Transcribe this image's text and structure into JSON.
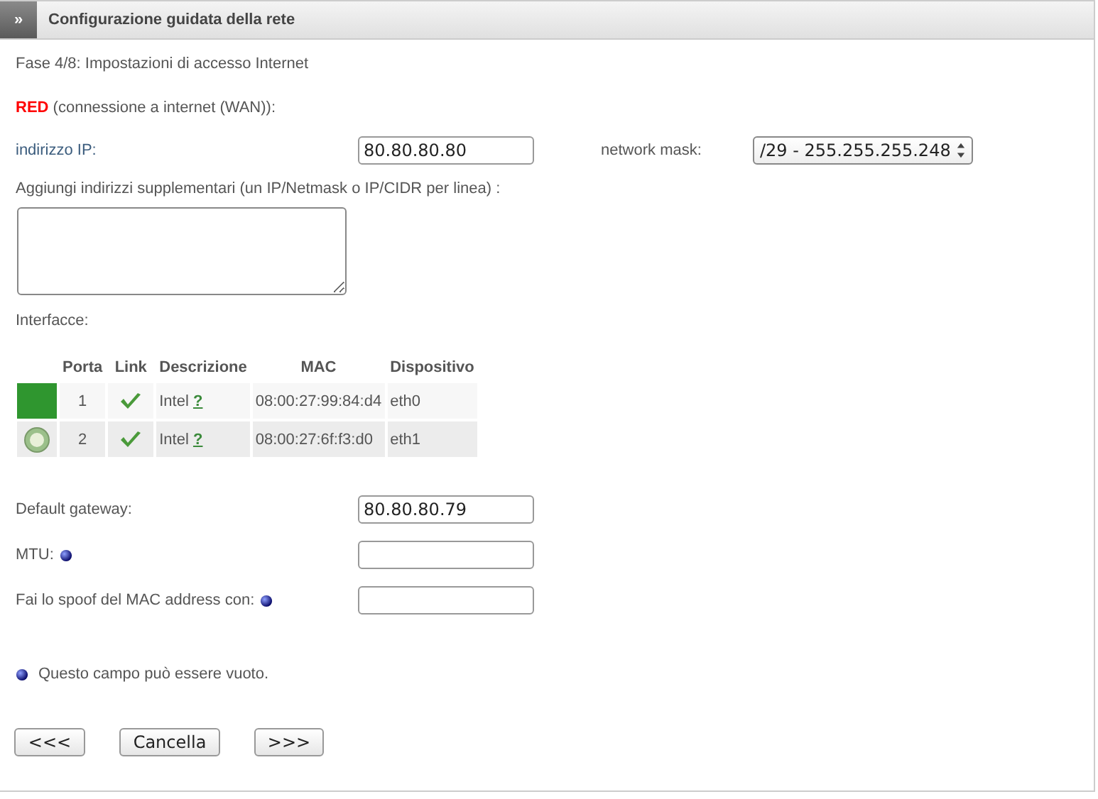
{
  "header": {
    "toggle": "»",
    "title": "Configurazione guidata della rete"
  },
  "step": "Fase 4/8: Impostazioni di accesso Internet",
  "zone": {
    "name": "RED",
    "description": "(connessione a internet (WAN)):"
  },
  "ip": {
    "label": "indirizzo IP:",
    "value": "80.80.80.80"
  },
  "netmask": {
    "label": "network mask:",
    "value": "/29 - 255.255.255.248"
  },
  "extra": {
    "label": "Aggiungi indirizzi supplementari (un IP/Netmask o IP/CIDR per linea) :"
  },
  "interfaces": {
    "label": "Interfacce:",
    "columns": [
      "Porta",
      "Link",
      "Descrizione",
      "MAC",
      "Dispositivo"
    ],
    "rows": [
      {
        "selected": true,
        "port": "1",
        "link": true,
        "description": "Intel",
        "help": "?",
        "mac": "08:00:27:99:84:d4",
        "device": "eth0"
      },
      {
        "selected": false,
        "port": "2",
        "link": true,
        "description": "Intel",
        "help": "?",
        "mac": "08:00:27:6f:f3:d0",
        "device": "eth1"
      }
    ]
  },
  "fields": [
    {
      "label": "Default gateway:",
      "optional": false,
      "value": "80.80.80.79"
    },
    {
      "label": "MTU:",
      "optional": true
    },
    {
      "label": "Fai lo spoof del MAC address con:",
      "optional": true
    }
  ],
  "note": "Questo campo può essere vuoto.",
  "buttons": [
    "<<<",
    "Cancella",
    ">>>"
  ]
}
